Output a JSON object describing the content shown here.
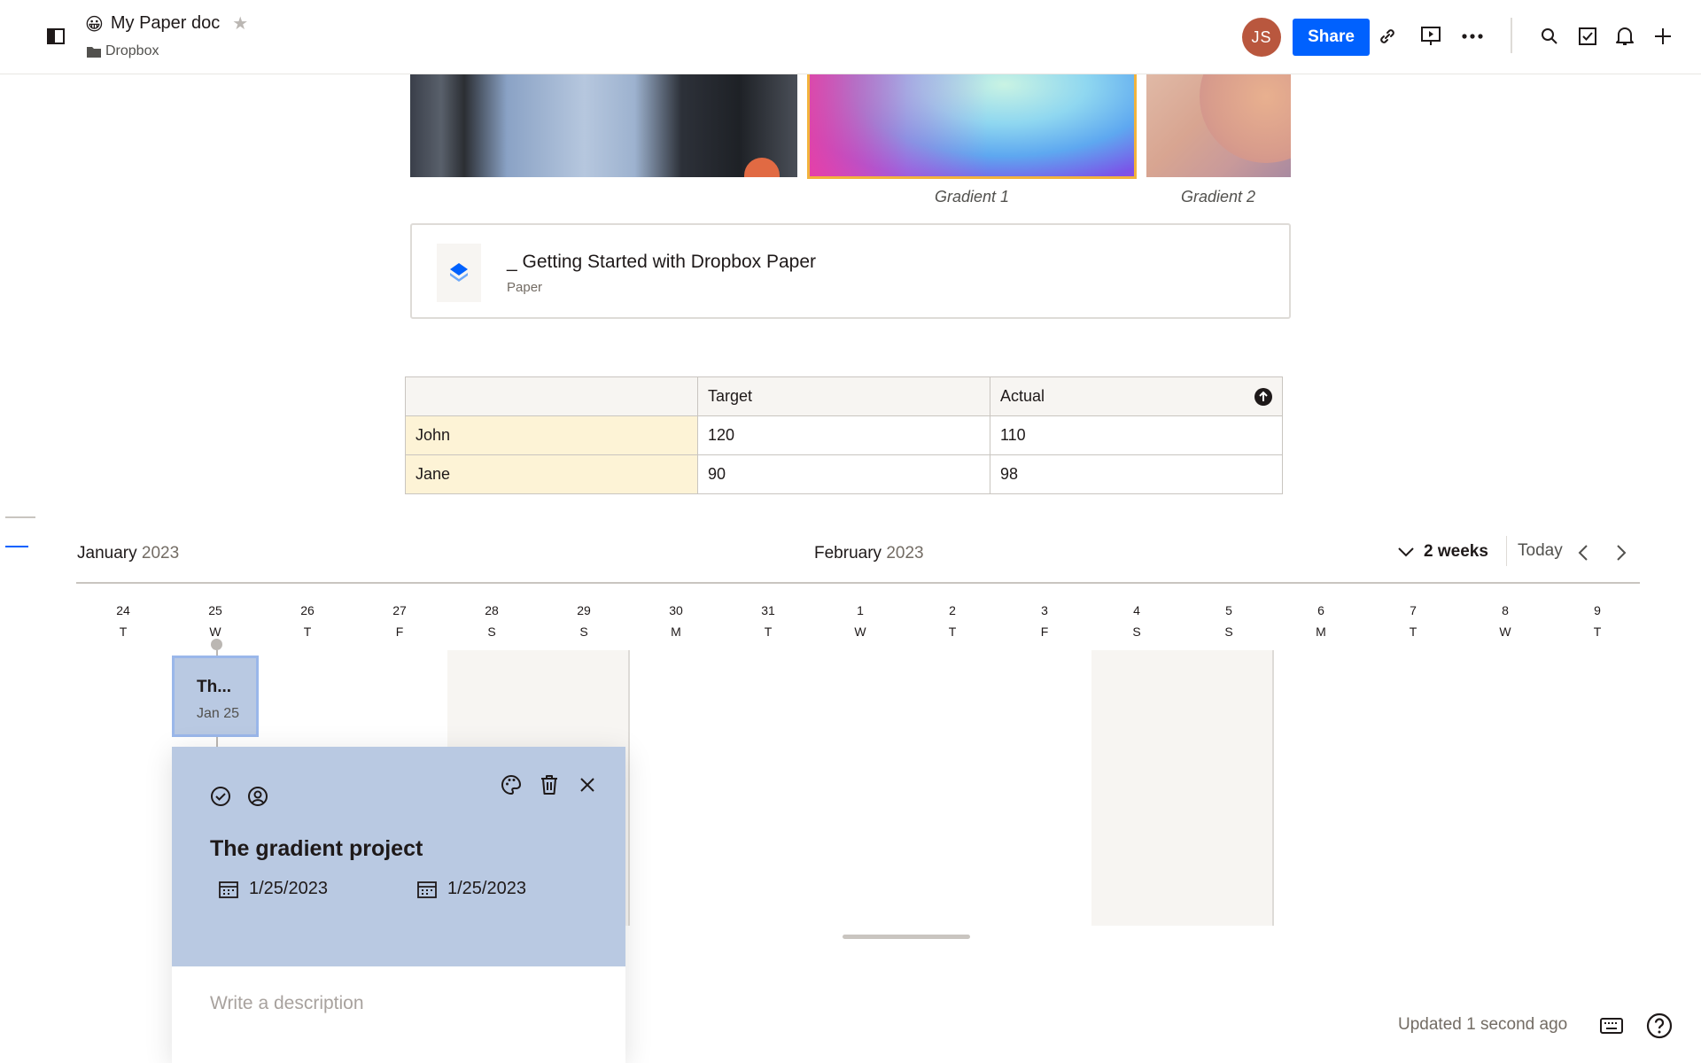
{
  "header": {
    "doc_emoji": "😀",
    "doc_title": "My Paper doc",
    "folder": "Dropbox",
    "avatar_initials": "JS",
    "avatar_color": "#b9573e",
    "share_label": "Share",
    "accent_color": "#0061fe",
    "icons": [
      "sidebar-toggle-icon",
      "star-icon",
      "folder-icon",
      "link-icon",
      "present-icon",
      "more-icon",
      "search-icon",
      "checklist-icon",
      "bell-icon",
      "plus-icon"
    ]
  },
  "images": {
    "captions": [
      "Gradient 1",
      "Gradient 2"
    ]
  },
  "link_card": {
    "title": "_ Getting Started with Dropbox Paper",
    "subtitle": "Paper"
  },
  "table": {
    "headers": [
      "",
      "Target",
      "Actual"
    ],
    "rows": [
      [
        "John",
        "120",
        "110"
      ],
      [
        "Jane",
        "90",
        "98"
      ]
    ]
  },
  "timeline": {
    "month1": "January",
    "year1": "2023",
    "month2": "February",
    "year2": "2023",
    "range": "2 weeks",
    "today_label": "Today",
    "days": [
      {
        "num": "24",
        "dow": "T"
      },
      {
        "num": "25",
        "dow": "W"
      },
      {
        "num": "26",
        "dow": "T"
      },
      {
        "num": "27",
        "dow": "F"
      },
      {
        "num": "28",
        "dow": "S"
      },
      {
        "num": "29",
        "dow": "S"
      },
      {
        "num": "30",
        "dow": "M"
      },
      {
        "num": "31",
        "dow": "T"
      },
      {
        "num": "1",
        "dow": "W"
      },
      {
        "num": "2",
        "dow": "T"
      },
      {
        "num": "3",
        "dow": "F"
      },
      {
        "num": "4",
        "dow": "S"
      },
      {
        "num": "5",
        "dow": "S"
      },
      {
        "num": "6",
        "dow": "M"
      },
      {
        "num": "7",
        "dow": "T"
      },
      {
        "num": "8",
        "dow": "W"
      },
      {
        "num": "9",
        "dow": "T"
      }
    ],
    "event_chip": {
      "title": "Th...",
      "date": "Jan 25"
    }
  },
  "popover": {
    "title": "The gradient project",
    "start_date": "1/25/2023",
    "end_date": "1/25/2023",
    "description_placeholder": "Write a description",
    "color": "#b9c9e2"
  },
  "footer": {
    "updated": "Updated 1 second ago"
  }
}
